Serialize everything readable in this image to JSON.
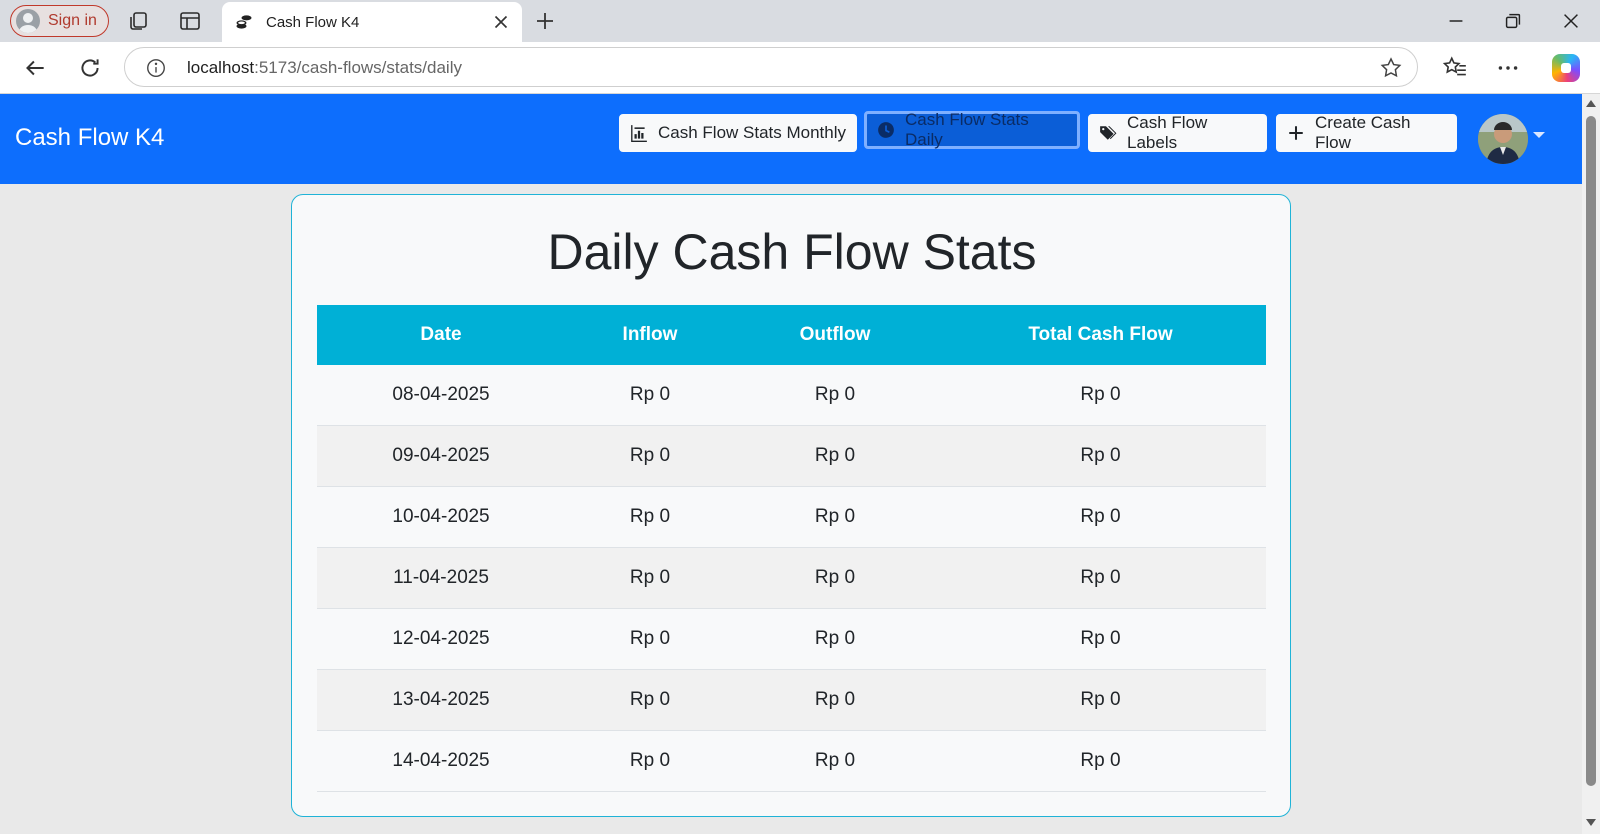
{
  "browser": {
    "signin_label": "Sign in",
    "tab_title": "Cash Flow K4",
    "url_host": "localhost",
    "url_path": ":5173/cash-flows/stats/daily"
  },
  "navbar": {
    "brand": "Cash Flow K4",
    "buttons": [
      {
        "label": "Cash Flow Stats Monthly",
        "icon": "bar-chart-icon",
        "active": false
      },
      {
        "label": "Cash Flow Stats Daily",
        "icon": "clock-icon",
        "active": true
      },
      {
        "label": "Cash Flow Labels",
        "icon": "tags-icon",
        "active": false
      },
      {
        "label": "Create Cash Flow",
        "icon": "plus-icon",
        "active": false
      }
    ]
  },
  "card": {
    "title": "Daily Cash Flow Stats",
    "columns": [
      "Date",
      "Inflow",
      "Outflow",
      "Total Cash Flow"
    ],
    "rows": [
      [
        "08-04-2025",
        "Rp 0",
        "Rp 0",
        "Rp 0"
      ],
      [
        "09-04-2025",
        "Rp 0",
        "Rp 0",
        "Rp 0"
      ],
      [
        "10-04-2025",
        "Rp 0",
        "Rp 0",
        "Rp 0"
      ],
      [
        "11-04-2025",
        "Rp 0",
        "Rp 0",
        "Rp 0"
      ],
      [
        "12-04-2025",
        "Rp 0",
        "Rp 0",
        "Rp 0"
      ],
      [
        "13-04-2025",
        "Rp 0",
        "Rp 0",
        "Rp 0"
      ],
      [
        "14-04-2025",
        "Rp 0",
        "Rp 0",
        "Rp 0"
      ]
    ]
  },
  "colors": {
    "navbar": "#0d6efd",
    "table_header": "#00b0d6",
    "card_border": "#1fb3d7"
  }
}
